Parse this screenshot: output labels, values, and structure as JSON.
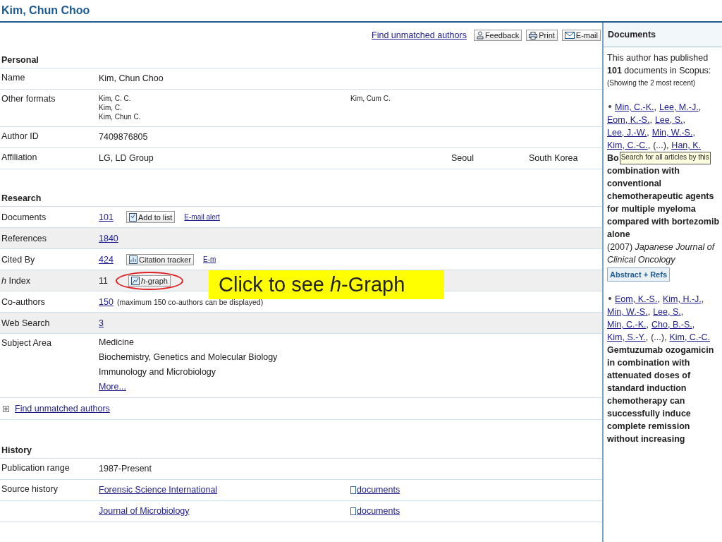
{
  "page_title": "Kim, Chun Choo",
  "toolbar": {
    "link": "Find unmatched authors",
    "buttons": [
      {
        "kind": "feedback",
        "label": "Feedback"
      },
      {
        "kind": "print",
        "label": "Print"
      },
      {
        "kind": "email",
        "label": "E-mail"
      }
    ]
  },
  "personal": {
    "heading": "Personal",
    "rows": [
      {
        "kind": "text",
        "label": "Name",
        "value": "Kim, Chun Choo"
      },
      {
        "kind": "formats",
        "label": "Other formats",
        "values": [
          "Kim, C. C.",
          "Kim, C.",
          "Kim, Chun C."
        ],
        "alt": "Kim, Cum C."
      },
      {
        "kind": "text",
        "label": "Author ID",
        "value": "7409876805"
      },
      {
        "kind": "affiliation",
        "label": "Affiliation",
        "value": "LG, LD Group",
        "city": "Seoul",
        "country": "South Korea"
      }
    ]
  },
  "research": {
    "heading": "Research",
    "rows": [
      {
        "label": "Documents",
        "value": "101",
        "button": {
          "kind": "list",
          "label": "Add to list"
        },
        "link": "E-mail alert",
        "shaded": false
      },
      {
        "label": "References",
        "value": "1840",
        "shaded": true
      },
      {
        "label": "Cited By",
        "value": "424",
        "button": {
          "kind": "chart",
          "label": "Citation tracker"
        },
        "link": "E-m",
        "shaded": false
      },
      {
        "label": "*h* Index",
        "value": "11",
        "button": {
          "kind": "graph",
          "label": "*h*-graph"
        },
        "highlighted": true,
        "shaded": true
      },
      {
        "label": "Co-authors",
        "value": "150",
        "note": "(maximum 150 co-authors can be displayed)",
        "shaded": false
      },
      {
        "label": "Web Search",
        "value": "3",
        "shaded": true
      }
    ],
    "subject": {
      "label": "Subject Area",
      "areas": [
        "Medicine",
        "Biochemistry, Genetics and Molecular Biology",
        "Immunology and Microbiology"
      ],
      "more": "More..."
    },
    "unmatched": {
      "expanded": false,
      "label": "Find unmatched authors"
    }
  },
  "callout": "Click to see *h*-Graph",
  "history": {
    "heading": "History",
    "range": {
      "label": "Publication range",
      "value": "1987-Present"
    },
    "source": {
      "label": "Source history",
      "items": [
        {
          "title": "Forensic Science International",
          "link": "documents"
        },
        {
          "title": "Journal of Microbiology",
          "link": "documents"
        }
      ]
    }
  },
  "sidebar": {
    "title": "Documents",
    "intro": "This author has published **101** documents in Scopus:",
    "note": "(Showing the 2 most recent)",
    "documents": [
      {
        "authors": [
          {
            "kind": "link",
            "text": "Min, C.-K.",
            "after": ","
          },
          {
            "kind": "link",
            "text": "Lee, M.-J.",
            "after": ","
          },
          {
            "kind": "link",
            "text": "Eom, K.-S.",
            "after": ","
          },
          {
            "kind": "link",
            "text": "Lee, S.",
            "after": ","
          },
          {
            "kind": "link",
            "text": "Lee, J.-W.",
            "after": ","
          },
          {
            "kind": "link",
            "text": "Min, W.-S.",
            "after": ","
          },
          {
            "kind": "link",
            "text": "Kim, C.-C.",
            "after": ","
          },
          {
            "kind": "text",
            "text": "(...)",
            "after": ","
          },
          {
            "kind": "link",
            "text": "Han, K."
          }
        ],
        "title_start": "Bo",
        "tooltip": "Search for all articles by this",
        "title": "combination with conventional chemotherapeutic agents for multiple myeloma compared with bortezomib alone",
        "year": "(2007)",
        "journal": "Japanese Journal of Clinical Oncology",
        "button": "Abstract + Refs"
      },
      {
        "authors": [
          {
            "kind": "link",
            "text": "Eom, K.-S.",
            "after": ","
          },
          {
            "kind": "link",
            "text": "Kim, H.-J.",
            "after": ","
          },
          {
            "kind": "link",
            "text": "Min, W.-S.",
            "after": ","
          },
          {
            "kind": "link",
            "text": "Lee, S.",
            "after": ","
          },
          {
            "kind": "link",
            "text": "Min, C.-K.",
            "after": ","
          },
          {
            "kind": "link",
            "text": "Cho, B.-S.",
            "after": ","
          },
          {
            "kind": "link",
            "text": "Kim, S.-Y.",
            "after": ","
          },
          {
            "kind": "text",
            "text": "(...)",
            "after": ","
          },
          {
            "kind": "link",
            "text": "Kim, C.-C."
          }
        ],
        "title": "Gemtuzumab ozogamicin in combination with attenuated doses of standard induction chemotherapy can successfully induce complete remission without increasing"
      }
    ]
  }
}
